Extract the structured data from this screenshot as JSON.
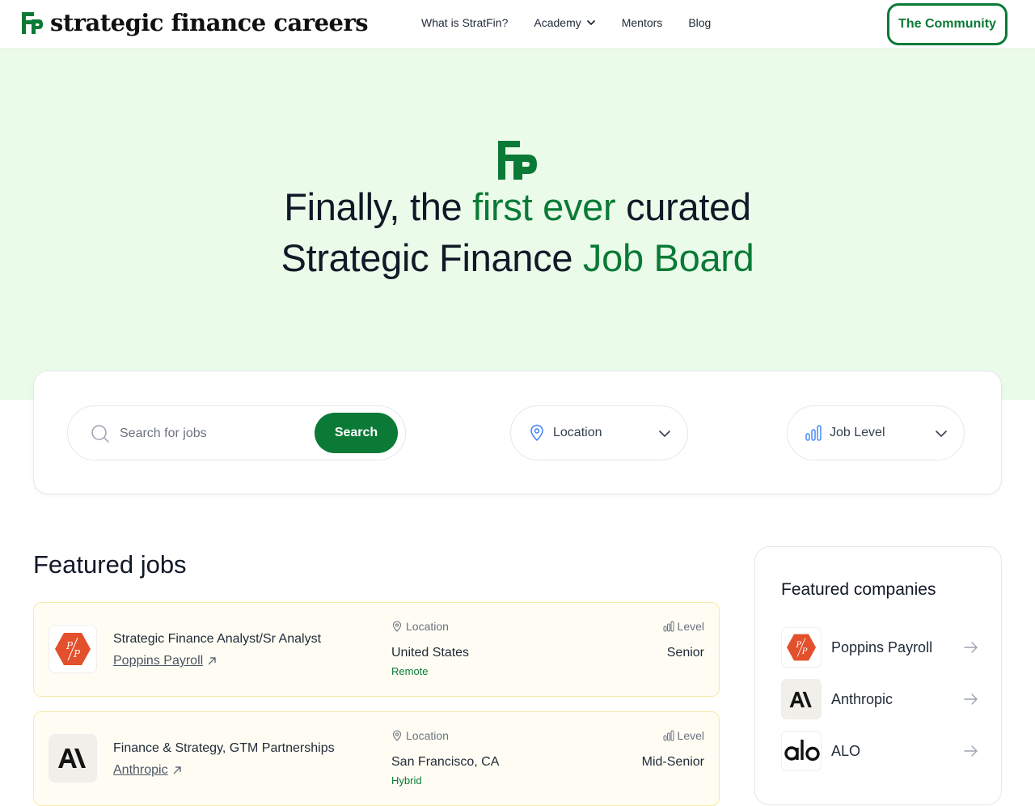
{
  "header": {
    "logo_text": "strategic finance careers",
    "nav": [
      {
        "label": "What is StratFin?"
      },
      {
        "label": "Academy"
      },
      {
        "label": "Mentors"
      },
      {
        "label": "Blog"
      }
    ],
    "cta_label": "The Community"
  },
  "hero": {
    "line1_a": "Finally, the ",
    "line1_b": "first ever",
    "line1_c": " curated",
    "line2_a": "Strategic Finance ",
    "line2_b": "Job Board"
  },
  "search": {
    "placeholder": "Search for jobs",
    "button_label": "Search",
    "location_label": "Location",
    "level_label": "Job Level"
  },
  "featured_jobs": {
    "title": "Featured jobs",
    "location_label": "Location",
    "level_label": "Level",
    "items": [
      {
        "title": "Strategic Finance Analyst/Sr Analyst",
        "company": "Poppins Payroll",
        "location": "United States",
        "location_note": "Remote",
        "level": "Senior"
      },
      {
        "title": "Finance & Strategy, GTM Partnerships",
        "company": "Anthropic",
        "location": "San Francisco, CA",
        "location_note": "Hybrid",
        "level": "Mid-Senior"
      }
    ]
  },
  "featured_companies": {
    "title": "Featured companies",
    "items": [
      {
        "name": "Poppins Payroll"
      },
      {
        "name": "Anthropic"
      },
      {
        "name": "ALO"
      }
    ]
  },
  "colors": {
    "brand_green": "#0a7a36",
    "hero_bg": "#eafbea",
    "job_card_bg": "#fffdf3",
    "poppins_red": "#e2502c"
  }
}
